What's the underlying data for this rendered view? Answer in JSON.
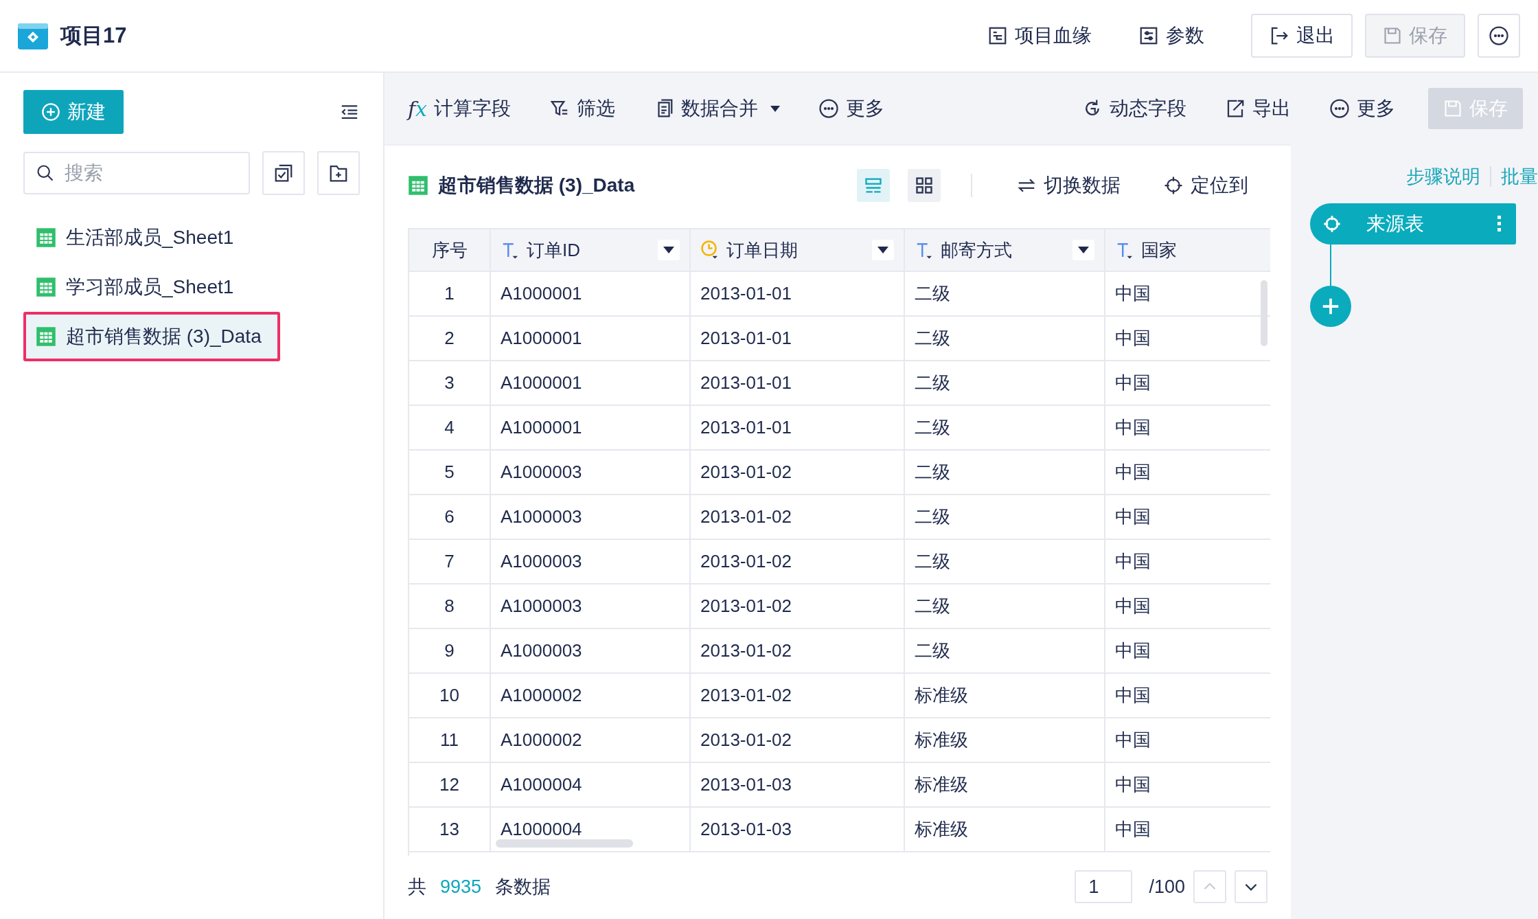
{
  "app": {
    "title": "项目17"
  },
  "header_actions": [
    {
      "kind": "lineage",
      "label": "项目血缘"
    },
    {
      "kind": "params",
      "label": "参数"
    }
  ],
  "header_buttons": [
    {
      "kind": "exit",
      "label": "退出",
      "disabled": false
    },
    {
      "kind": "save",
      "label": "保存",
      "disabled": true
    }
  ],
  "sidebar": {
    "new_button": "新建",
    "search": {
      "placeholder": "搜索"
    },
    "items": [
      {
        "label": "生活部成员_Sheet1",
        "selected": false
      },
      {
        "label": "学习部成员_Sheet1",
        "selected": false
      },
      {
        "label": "超市销售数据 (3)_Data",
        "selected": true
      }
    ]
  },
  "toolbar": {
    "left": [
      {
        "kind": "formula",
        "icon": "fx",
        "label": "计算字段",
        "dropdown": false
      },
      {
        "kind": "filter",
        "label": "筛选",
        "dropdown": false
      },
      {
        "kind": "merge",
        "label": "数据合并",
        "dropdown": true
      },
      {
        "kind": "more",
        "label": "更多",
        "dropdown": false
      }
    ],
    "right": [
      {
        "kind": "dynamic",
        "label": "动态字段"
      },
      {
        "kind": "export",
        "label": "导出"
      },
      {
        "kind": "more",
        "label": "更多"
      }
    ],
    "save": {
      "label": "保存",
      "disabled": true
    }
  },
  "dataset": {
    "title": "超市销售数据 (3)_Data",
    "views": [
      {
        "kind": "list",
        "selected": true
      },
      {
        "kind": "grid",
        "selected": false
      }
    ],
    "actions": [
      {
        "kind": "switch",
        "label": "切换数据"
      },
      {
        "kind": "locate",
        "label": "定位到"
      }
    ]
  },
  "table": {
    "columns": [
      {
        "label": "序号",
        "kind": "index",
        "filter": false
      },
      {
        "label": "订单ID",
        "kind": "text",
        "filter": true
      },
      {
        "label": "订单日期",
        "kind": "date",
        "filter": true
      },
      {
        "label": "邮寄方式",
        "kind": "text",
        "filter": true
      },
      {
        "label": "国家",
        "kind": "text",
        "filter": false
      }
    ],
    "rows": [
      [
        "1",
        "A1000001",
        "2013-01-01",
        "二级",
        "中国"
      ],
      [
        "2",
        "A1000001",
        "2013-01-01",
        "二级",
        "中国"
      ],
      [
        "3",
        "A1000001",
        "2013-01-01",
        "二级",
        "中国"
      ],
      [
        "4",
        "A1000001",
        "2013-01-01",
        "二级",
        "中国"
      ],
      [
        "5",
        "A1000003",
        "2013-01-02",
        "二级",
        "中国"
      ],
      [
        "6",
        "A1000003",
        "2013-01-02",
        "二级",
        "中国"
      ],
      [
        "7",
        "A1000003",
        "2013-01-02",
        "二级",
        "中国"
      ],
      [
        "8",
        "A1000003",
        "2013-01-02",
        "二级",
        "中国"
      ],
      [
        "9",
        "A1000003",
        "2013-01-02",
        "二级",
        "中国"
      ],
      [
        "10",
        "A1000002",
        "2013-01-02",
        "标准级",
        "中国"
      ],
      [
        "11",
        "A1000002",
        "2013-01-02",
        "标准级",
        "中国"
      ],
      [
        "12",
        "A1000004",
        "2013-01-03",
        "标准级",
        "中国"
      ],
      [
        "13",
        "A1000004",
        "2013-01-03",
        "标准级",
        "中国"
      ]
    ]
  },
  "footer": {
    "prefix": "共",
    "count": "9935",
    "suffix": "条数据",
    "page": "1",
    "total": "/100"
  },
  "steps": {
    "links": [
      "步骤说明",
      "批量"
    ],
    "nodes": [
      {
        "label": "来源表"
      }
    ]
  }
}
